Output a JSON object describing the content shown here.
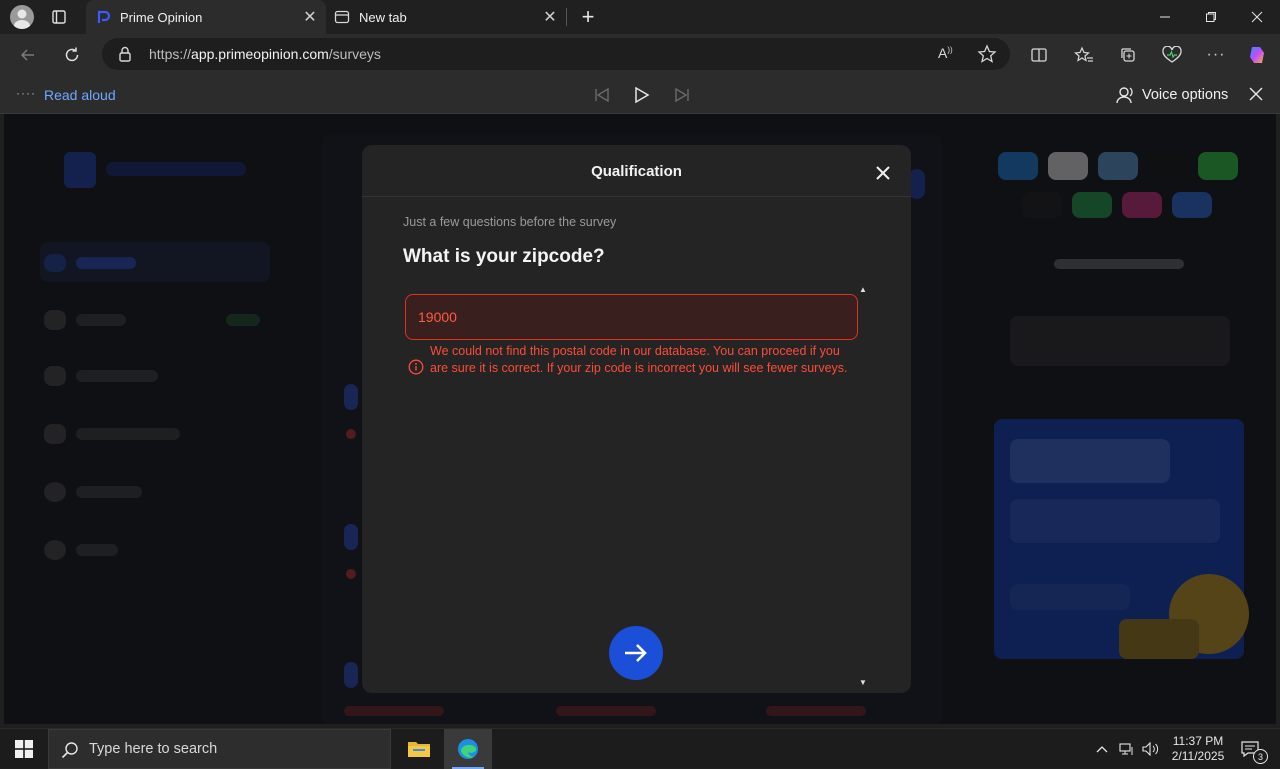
{
  "browser": {
    "tabs": [
      {
        "title": "Prime Opinion",
        "active": true
      },
      {
        "title": "New tab",
        "active": false
      }
    ],
    "url_scheme": "https://",
    "url_host": "app.primeopinion.com",
    "url_path": "/surveys",
    "read_aloud": {
      "label": "Read aloud",
      "voice_options_label": "Voice options"
    }
  },
  "modal": {
    "title": "Qualification",
    "subtitle": "Just a few questions before the survey",
    "question": "What is your zipcode?",
    "input_value": "19000",
    "error_message": "We could not find this postal code in our database. You can proceed if you are sure it is correct. If your zip code is incorrect you will see fewer surveys."
  },
  "taskbar": {
    "search_placeholder": "Type here to search",
    "time": "11:37 PM",
    "date": "2/11/2025",
    "notification_count": "3"
  },
  "colors": {
    "accent_blue": "#1b4fd8",
    "error_red": "#ff4a3a",
    "modal_bg": "#242424"
  }
}
